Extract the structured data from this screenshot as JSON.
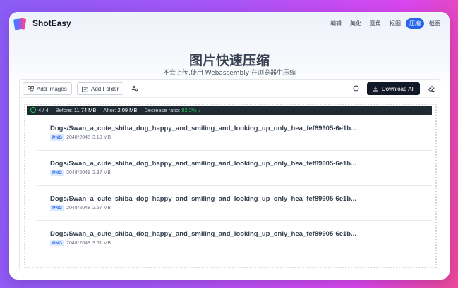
{
  "app": {
    "name": "ShotEasy"
  },
  "nav": {
    "items": [
      "编辑",
      "美化",
      "圆角",
      "抠图",
      "压缩",
      "截图"
    ],
    "active": "压缩"
  },
  "hero": {
    "title": "图片快速压缩",
    "subtitle": "不会上传,使用 Webassembly 在浏览器中压缩"
  },
  "toolbar": {
    "add_images": "Add Images",
    "add_folder": "Add Folder",
    "download_all": "Download All"
  },
  "status": {
    "count": "4 / 4",
    "before_label": "Before:",
    "before_value": "11.74 MB",
    "after_label": "After:",
    "after_value": "2.09 MB",
    "ratio_label": "Decrease ratio:",
    "ratio_value": "82.2% ↓"
  },
  "files": [
    {
      "name": "Dogs/Swan_a_cute_shiba_dog_happy_and_smiling_and_looking_up_only_hea_fef89905-6e1b...",
      "type": "PNG",
      "dims": "2048*2048",
      "size": "3.19 MB"
    },
    {
      "name": "Dogs/Swan_a_cute_shiba_dog_happy_and_smiling_and_looking_up_only_hea_fef89905-6e1b...",
      "type": "PNG",
      "dims": "2048*2048",
      "size": "2.37 MB"
    },
    {
      "name": "Dogs/Swan_a_cute_shiba_dog_happy_and_smiling_and_looking_up_only_hea_fef89905-6e1b...",
      "type": "PNG",
      "dims": "2048*2048",
      "size": "2.57 MB"
    },
    {
      "name": "Dogs/Swan_a_cute_shiba_dog_happy_and_smiling_and_looking_up_only_hea_fef89905-6e1b...",
      "type": "PNG",
      "dims": "2048*2048",
      "size": "3.61 MB"
    }
  ],
  "colors": {
    "accent": "#2563eb",
    "success": "#22c55e",
    "dark": "#111827"
  }
}
